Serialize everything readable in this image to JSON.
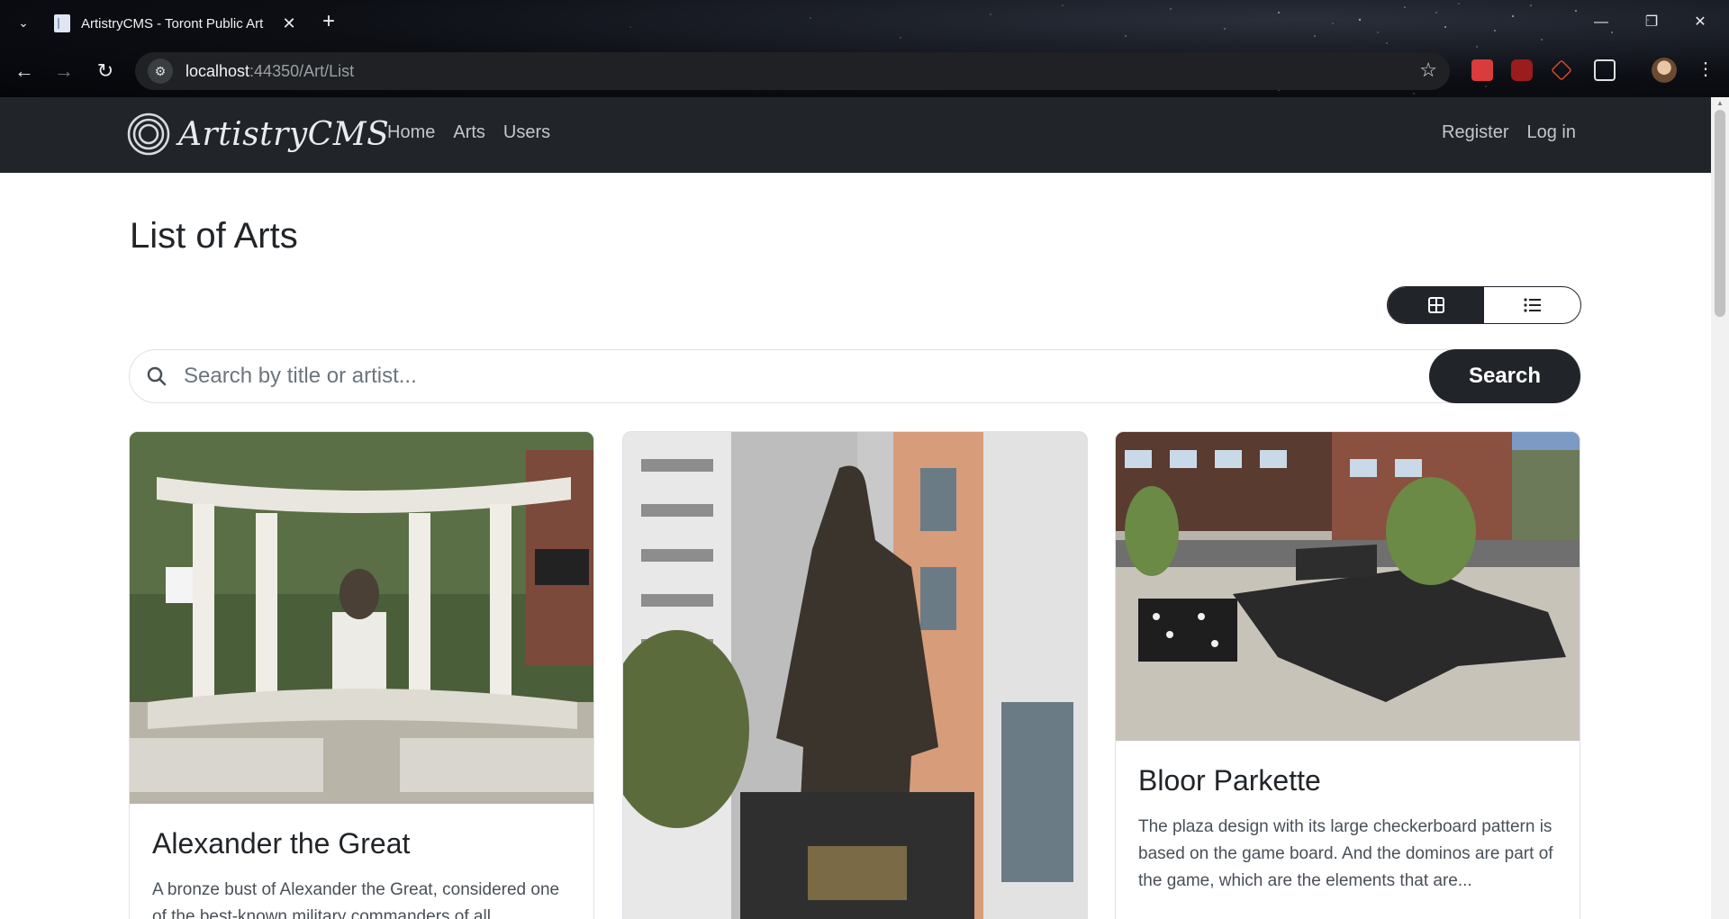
{
  "browser": {
    "tab_title": "ArtistryCMS - Toront Public Art",
    "url_host": "localhost",
    "url_path": ":44350/Art/List",
    "new_tab_symbol": "+",
    "close_symbol": "✕"
  },
  "navbar": {
    "brand": "ArtistryCMS",
    "links": [
      "Home",
      "Arts",
      "Users"
    ],
    "right_links": [
      "Register",
      "Log in"
    ]
  },
  "page": {
    "title": "List of Arts",
    "view_modes": [
      "grid-icon",
      "list-icon"
    ],
    "active_view": "grid"
  },
  "search": {
    "placeholder": "Search by title or artist...",
    "button_label": "Search"
  },
  "cards": [
    {
      "title": "Alexander the Great",
      "description": "A bronze bust of Alexander the Great, considered one of the best-known military commanders of all"
    },
    {
      "title": "",
      "description": ""
    },
    {
      "title": "Bloor Parkette",
      "description": "The plaza design with its large checkerboard pattern is based on the game board. And the dominos are part of the game, which are the elements that are..."
    }
  ],
  "colors": {
    "navbar_bg": "#212529",
    "accent_dark": "#212529",
    "card_border": "#dee2e6"
  }
}
